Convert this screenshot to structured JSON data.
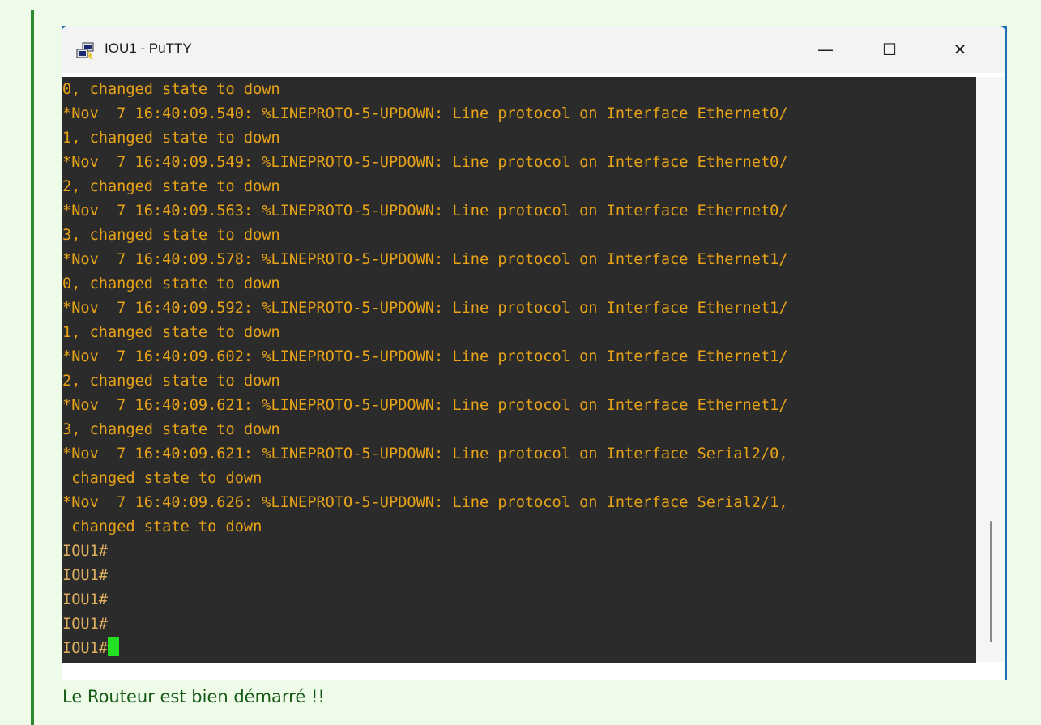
{
  "window": {
    "title": "IOU1 - PuTTY",
    "minimize_glyph": "—",
    "maximize_glyph": "☐",
    "close_glyph": "✕"
  },
  "terminal": {
    "lines": [
      "0, changed state to down",
      "*Nov  7 16:40:09.540: %LINEPROTO-5-UPDOWN: Line protocol on Interface Ethernet0/",
      "1, changed state to down",
      "*Nov  7 16:40:09.549: %LINEPROTO-5-UPDOWN: Line protocol on Interface Ethernet0/",
      "2, changed state to down",
      "*Nov  7 16:40:09.563: %LINEPROTO-5-UPDOWN: Line protocol on Interface Ethernet0/",
      "3, changed state to down",
      "*Nov  7 16:40:09.578: %LINEPROTO-5-UPDOWN: Line protocol on Interface Ethernet1/",
      "0, changed state to down",
      "*Nov  7 16:40:09.592: %LINEPROTO-5-UPDOWN: Line protocol on Interface Ethernet1/",
      "1, changed state to down",
      "*Nov  7 16:40:09.602: %LINEPROTO-5-UPDOWN: Line protocol on Interface Ethernet1/",
      "2, changed state to down",
      "*Nov  7 16:40:09.621: %LINEPROTO-5-UPDOWN: Line protocol on Interface Ethernet1/",
      "3, changed state to down",
      "*Nov  7 16:40:09.621: %LINEPROTO-5-UPDOWN: Line protocol on Interface Serial2/0,",
      " changed state to down",
      "*Nov  7 16:40:09.626: %LINEPROTO-5-UPDOWN: Line protocol on Interface Serial2/1,",
      " changed state to down",
      "IOU1#",
      "IOU1#",
      "IOU1#",
      "IOU1#"
    ],
    "current_prompt": "IOU1#"
  },
  "caption": "Le Routeur est bien démarré !!",
  "colors": {
    "terminal_bg": "#2b2b2b",
    "terminal_text": "#e8a317",
    "cursor": "#23e023",
    "page_bg": "#eefbe9",
    "accent_bar": "#2e8b2e"
  },
  "icons": {
    "app": "putty-icon"
  }
}
